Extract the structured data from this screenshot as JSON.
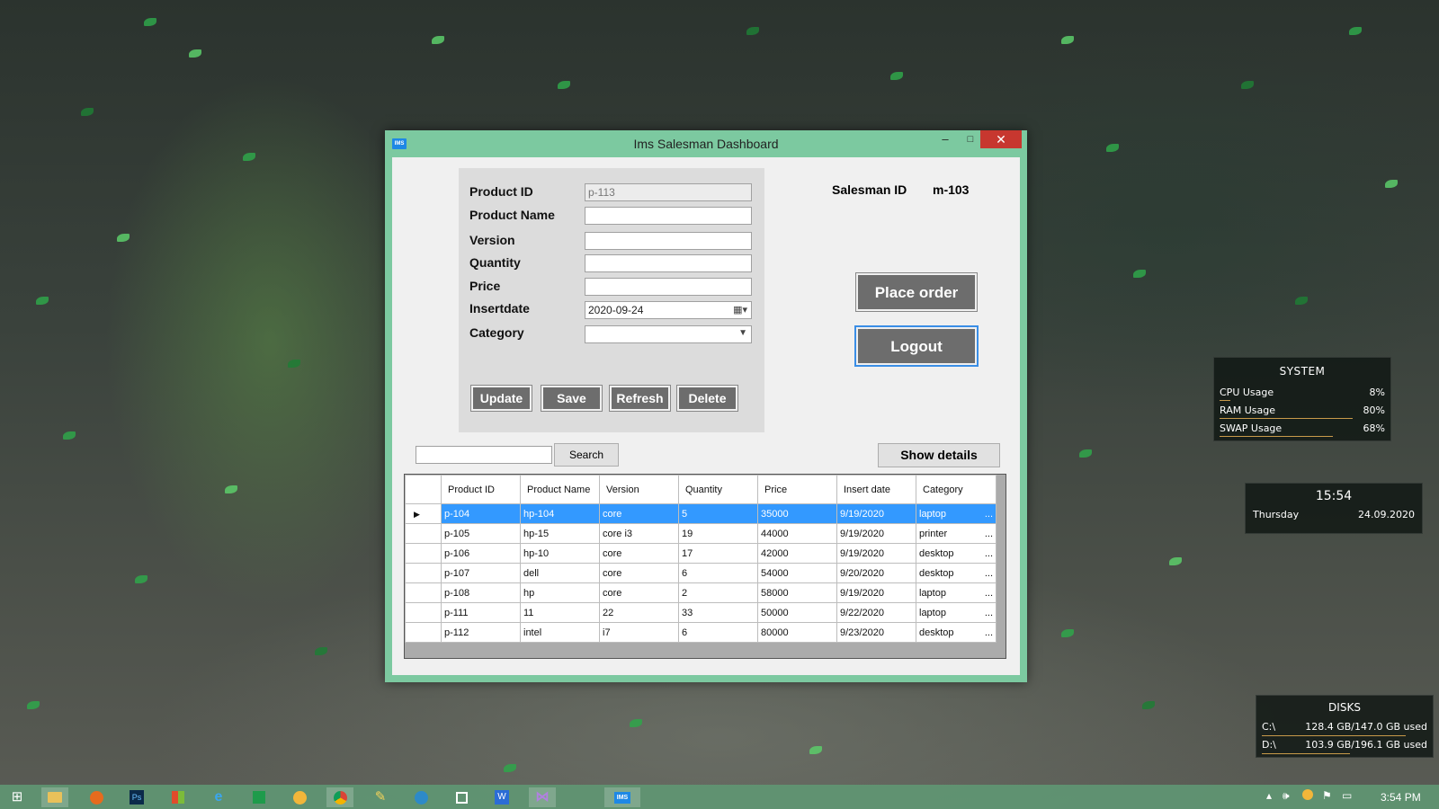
{
  "window": {
    "title": "Ims Salesman  Dashboard",
    "icon_text": "IMS",
    "min": "–",
    "max": "□",
    "close": "✕"
  },
  "form": {
    "labels": [
      "Product ID",
      "Product Name",
      "Version",
      "Quantity",
      "Price",
      "Insertdate",
      "Category"
    ],
    "product_id_value": "p-113",
    "product_name_value": "",
    "version_value": "",
    "quantity_value": "",
    "price_value": "",
    "insertdate_value": "2020-09-24",
    "category_value": "",
    "buttons": {
      "update": "Update",
      "save": "Save",
      "refresh": "Refresh",
      "delete": "Delete"
    }
  },
  "salesman": {
    "label": "Salesman ID",
    "value": "m-103"
  },
  "actions": {
    "place_order": "Place order",
    "logout": "Logout"
  },
  "search": {
    "value": "",
    "button": "Search"
  },
  "details_button": "Show details",
  "grid": {
    "headers": [
      "Product ID",
      "Product Name",
      "Version",
      "Quantity",
      "Price",
      "Insert date",
      "Category"
    ],
    "rows": [
      [
        "p-104",
        "hp-104",
        "core",
        "5",
        "35000",
        "9/19/2020",
        "laptop"
      ],
      [
        "p-105",
        "hp-15",
        "core i3",
        "19",
        "44000",
        "9/19/2020",
        "printer"
      ],
      [
        "p-106",
        "hp-10",
        "core",
        "17",
        "42000",
        "9/19/2020",
        "desktop"
      ],
      [
        "p-107",
        "dell",
        "core",
        "6",
        "54000",
        "9/20/2020",
        "desktop"
      ],
      [
        "p-108",
        "hp",
        "core",
        "2",
        "58000",
        "9/19/2020",
        "laptop"
      ],
      [
        "p-111",
        "11",
        "22",
        "33",
        "50000",
        "9/22/2020",
        "laptop"
      ],
      [
        "p-112",
        "intel",
        "i7",
        "6",
        "80000",
        "9/23/2020",
        "desktop"
      ]
    ],
    "selected_row": 0,
    "ellipsis": "..."
  },
  "widgets": {
    "system": {
      "title": "SYSTEM",
      "rows": [
        {
          "label": "CPU Usage",
          "value": "8%",
          "level": 0.08
        },
        {
          "label": "RAM Usage",
          "value": "80%",
          "level": 0.8
        },
        {
          "label": "SWAP Usage",
          "value": "68%",
          "level": 0.68
        }
      ]
    },
    "clock": {
      "time": "15:54",
      "day": "Thursday",
      "date": "24.09.2020"
    },
    "disks": {
      "title": "DISKS",
      "rows": [
        {
          "label": "C:\\",
          "value": "128.4 GB/147.0 GB used",
          "level": 0.87
        },
        {
          "label": "D:\\",
          "value": "103.9 GB/196.1 GB used",
          "level": 0.53
        }
      ]
    }
  },
  "taskbar": {
    "clock": "3:54 PM",
    "icons": [
      "windows-start-icon",
      "file-explorer-icon",
      "firefox-icon",
      "photoshop-icon",
      "office-icon",
      "internet-explorer-icon",
      "excel-icon",
      "chrome-canary-icon",
      "chrome-icon",
      "tool-icon",
      "kodi-icon",
      "dev-tool-icon",
      "word-icon",
      "visual-studio-icon",
      "ims-app-icon"
    ],
    "ps_text": "Ps",
    "word_text": "W",
    "ims_text": "IMS"
  }
}
